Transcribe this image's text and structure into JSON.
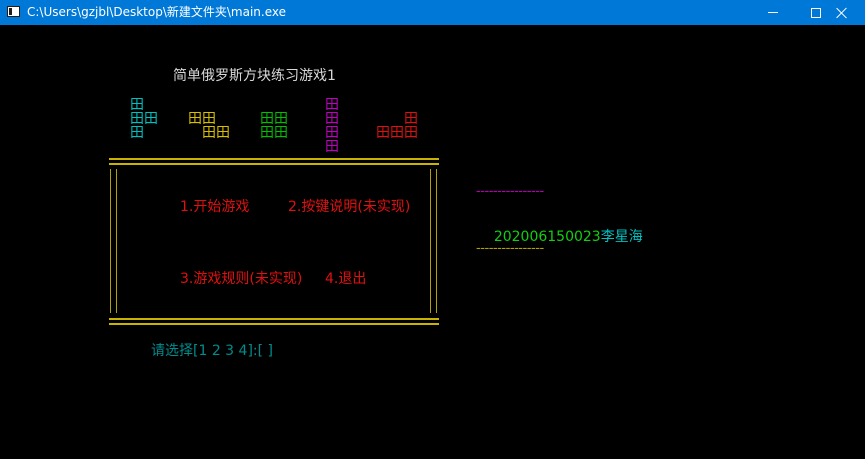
{
  "window": {
    "title": "C:\\Users\\gzjbl\\Desktop\\新建文件夹\\main.exe"
  },
  "console": {
    "game_title": "简单俄罗斯方块练习游戏1",
    "block_glyph": "田",
    "pieces": [
      {
        "name": "T-piece",
        "color": "#00c0c0"
      },
      {
        "name": "Z-piece",
        "color": "#d8c000"
      },
      {
        "name": "O-piece",
        "color": "#00c000"
      },
      {
        "name": "I-piece",
        "color": "#c000c0"
      },
      {
        "name": "L-piece",
        "color": "#e01010"
      }
    ],
    "menu": {
      "option1": "1.开始游戏",
      "option2": "2.按键说明(未实现)",
      "option3": "3.游戏规则(未实现)",
      "option4": "4.退出"
    },
    "prompt": "请选择[1 2 3 4]:[ ]",
    "author": "202006150023李星海",
    "separator": "----------------"
  },
  "colors": {
    "titlebar": "#0078d7",
    "background": "#000000",
    "menu_text": "#e01010",
    "frame": "#c8b400",
    "prompt": "#008c8c",
    "author_id": "#10d010",
    "author_name": "#00c0c0"
  }
}
